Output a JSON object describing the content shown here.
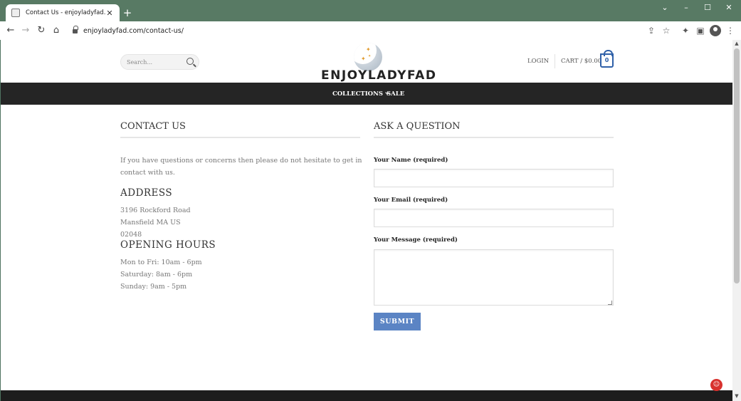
{
  "browser": {
    "tab_title": "Contact Us - enjoyladyfad.com",
    "tab_close": "✕",
    "new_tab": "+",
    "url": "enjoyladyfad.com/contact-us/",
    "icons": {
      "back": "←",
      "forward": "→",
      "reload": "↻",
      "home": "⌂",
      "share": "⇪",
      "bookmark": "☆",
      "extensions": "✦",
      "sidebar": "▣",
      "menu": "⋮",
      "minimize": "–",
      "maximize": "☐",
      "close": "✕",
      "tab_list": "⌄"
    }
  },
  "header": {
    "search_placeholder": "Search...",
    "logo_text": "ENJOYLADYFAD",
    "login": "LOGIN",
    "cart_label": "CART / $0.00",
    "cart_count": "0"
  },
  "nav": {
    "items": [
      "COLLECTIONS",
      "SALE"
    ]
  },
  "contact": {
    "title": "CONTACT US",
    "intro_line1": "If you have questions or concerns then please do not hesitate to get in",
    "intro_line2": "contact with us.",
    "address_heading": "ADDRESS",
    "address_lines": [
      "3196 Rockford Road",
      "Mansfield MA US",
      "02048"
    ],
    "hours_heading": "OPENING HOURS",
    "hours_lines": [
      "Mon to Fri: 10am - 6pm",
      "Saturday: 8am - 6pm",
      "Sunday: 9am - 5pm"
    ]
  },
  "form": {
    "title": "ASK A QUESTION",
    "name_label": "Your Name (required)",
    "name_value": "",
    "email_label": "Your Email (required)",
    "email_value": "",
    "message_label": "Your Message (required)",
    "message_value": "",
    "submit": "SUBMIT"
  },
  "colors": {
    "chrome": "#587a64",
    "navbar": "#252525",
    "accent_blue": "#2f60a8",
    "submit_blue": "#5b84c4"
  }
}
